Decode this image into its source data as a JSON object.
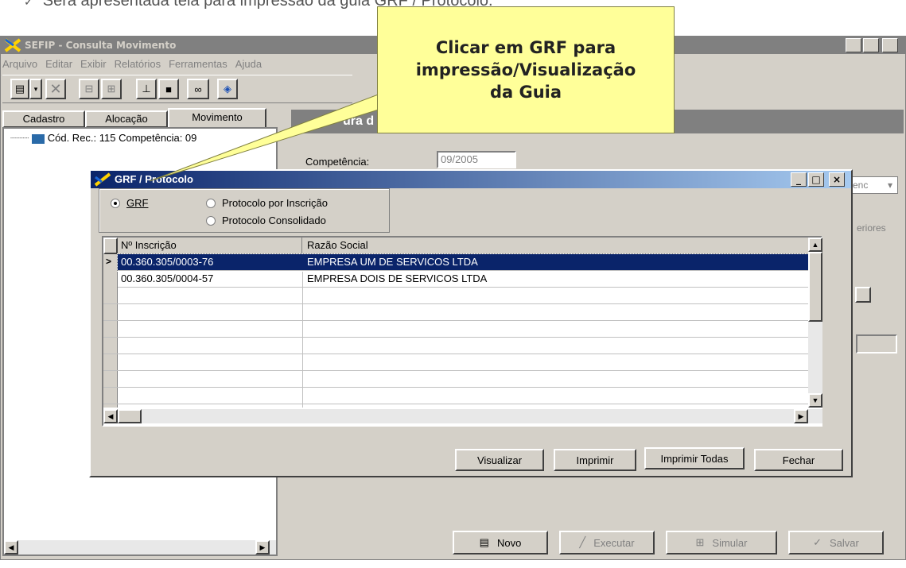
{
  "slide_bullet": "Será apresentada tela para impressão da guia GRF / Protocolo.",
  "main_window": {
    "title": "SEFIP - Consulta Movimento",
    "menu": [
      "Arquivo",
      "Editar",
      "Exibir",
      "Relatórios",
      "Ferramentas",
      "Ajuda"
    ],
    "tabs": [
      "Cadastro",
      "Alocação",
      "Movimento"
    ],
    "active_tab": "Movimento",
    "tree_item": "Cód. Rec.: 115 Competência: 09",
    "panel_header": "ura d",
    "competencia_label": "Competência:",
    "competencia_value": "09/2005",
    "right_fragment_1": "enc",
    "right_fragment_2": "eriores"
  },
  "callout": {
    "text": "Clicar em GRF para impressão/Visualização da Guia"
  },
  "dialog": {
    "title": "GRF / Protocolo",
    "options": [
      "GRF",
      "Protocolo por Inscrição",
      "Protocolo Consolidado"
    ],
    "selected_option": "GRF",
    "columns": [
      "Nº Inscrição",
      "Razão Social"
    ],
    "rows": [
      {
        "inscricao": "00.360.305/0003-76",
        "razao": "EMPRESA UM DE SERVICOS LTDA"
      },
      {
        "inscricao": "00.360.305/0004-57",
        "razao": "EMPRESA DOIS DE SERVICOS LTDA"
      }
    ],
    "buttons": [
      "Visualizar",
      "Imprimir",
      "Imprimir Todas",
      "Fechar"
    ]
  },
  "bottom_buttons": [
    "Novo",
    "Executar",
    "Simular",
    "Salvar"
  ],
  "colors": {
    "titlebar": "#0a246a",
    "face": "#d4d0c8",
    "callout": "#ffff99",
    "selected_row": "#0a246a"
  }
}
